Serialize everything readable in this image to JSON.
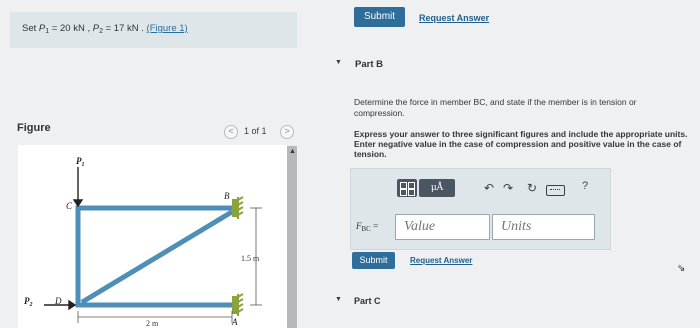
{
  "problem": {
    "prefix": "Set ",
    "p1_symbol": "P",
    "p1_sub": "1",
    "p1_value": " = 20  kN , ",
    "p2_symbol": "P",
    "p2_sub": "2",
    "p2_value": " = 17  kN . ",
    "figure_link": "(Figure 1)"
  },
  "figure": {
    "label": "Figure",
    "pager_text": "1 of 1",
    "prev_glyph": "<",
    "next_glyph": ">",
    "labels": {
      "p1": "P",
      "p1_sub": "1",
      "c": "C",
      "b": "B",
      "p2": "P",
      "p2_sub": "2",
      "d": "D",
      "a": "A",
      "height": "1.5 m",
      "width": "2 m"
    },
    "colors": {
      "member": "#4f8fb7",
      "support": "#8aa33c",
      "background": "#ffffff"
    }
  },
  "toolbar_top": {
    "submit": "Submit",
    "request_answer": "Request Answer"
  },
  "part_b": {
    "label": "Part B",
    "question": "Determine the force in member BC, and state if the member is in tension or compression.",
    "instructions": "Express your answer to three significant figures and include the appropriate units. Enter negative value in the case of compression and positive value in the case of tension.",
    "toolbar": {
      "units_button": "μÅ",
      "undo_icon": "undo-icon",
      "redo_icon": "redo-icon",
      "reset_icon": "reset-icon",
      "keyboard_icon": "keyboard-icon",
      "help": "?"
    },
    "answer_label_main": "F",
    "answer_label_sub": "BC",
    "answer_label_eq": " =",
    "value_placeholder": "Value",
    "units_placeholder": "Units",
    "submit": "Submit",
    "request_answer": "Request Answer"
  },
  "part_c": {
    "label": "Part C"
  },
  "accent_color": "#2f6d9a"
}
